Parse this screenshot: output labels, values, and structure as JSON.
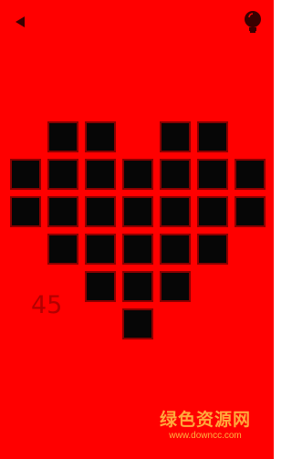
{
  "colors": {
    "background": "#ff0000",
    "tile_fill": "#060606",
    "tile_border": "#8a0000",
    "counter": "#b30000",
    "icon": "#3a0000",
    "watermark": "#ffd24a"
  },
  "header": {
    "back_icon": "back-triangle-icon",
    "hint_icon": "lightbulb-icon"
  },
  "game": {
    "pattern": [
      [
        0,
        1,
        1,
        0,
        1,
        1,
        0
      ],
      [
        1,
        1,
        1,
        1,
        1,
        1,
        1
      ],
      [
        1,
        1,
        1,
        1,
        1,
        1,
        1
      ],
      [
        0,
        1,
        1,
        1,
        1,
        1,
        0
      ],
      [
        0,
        0,
        1,
        1,
        1,
        0,
        0
      ],
      [
        0,
        0,
        0,
        1,
        0,
        0,
        0
      ]
    ],
    "counter": "45"
  },
  "watermark": {
    "name": "绿色资源网",
    "url": "www.downcc.com"
  }
}
